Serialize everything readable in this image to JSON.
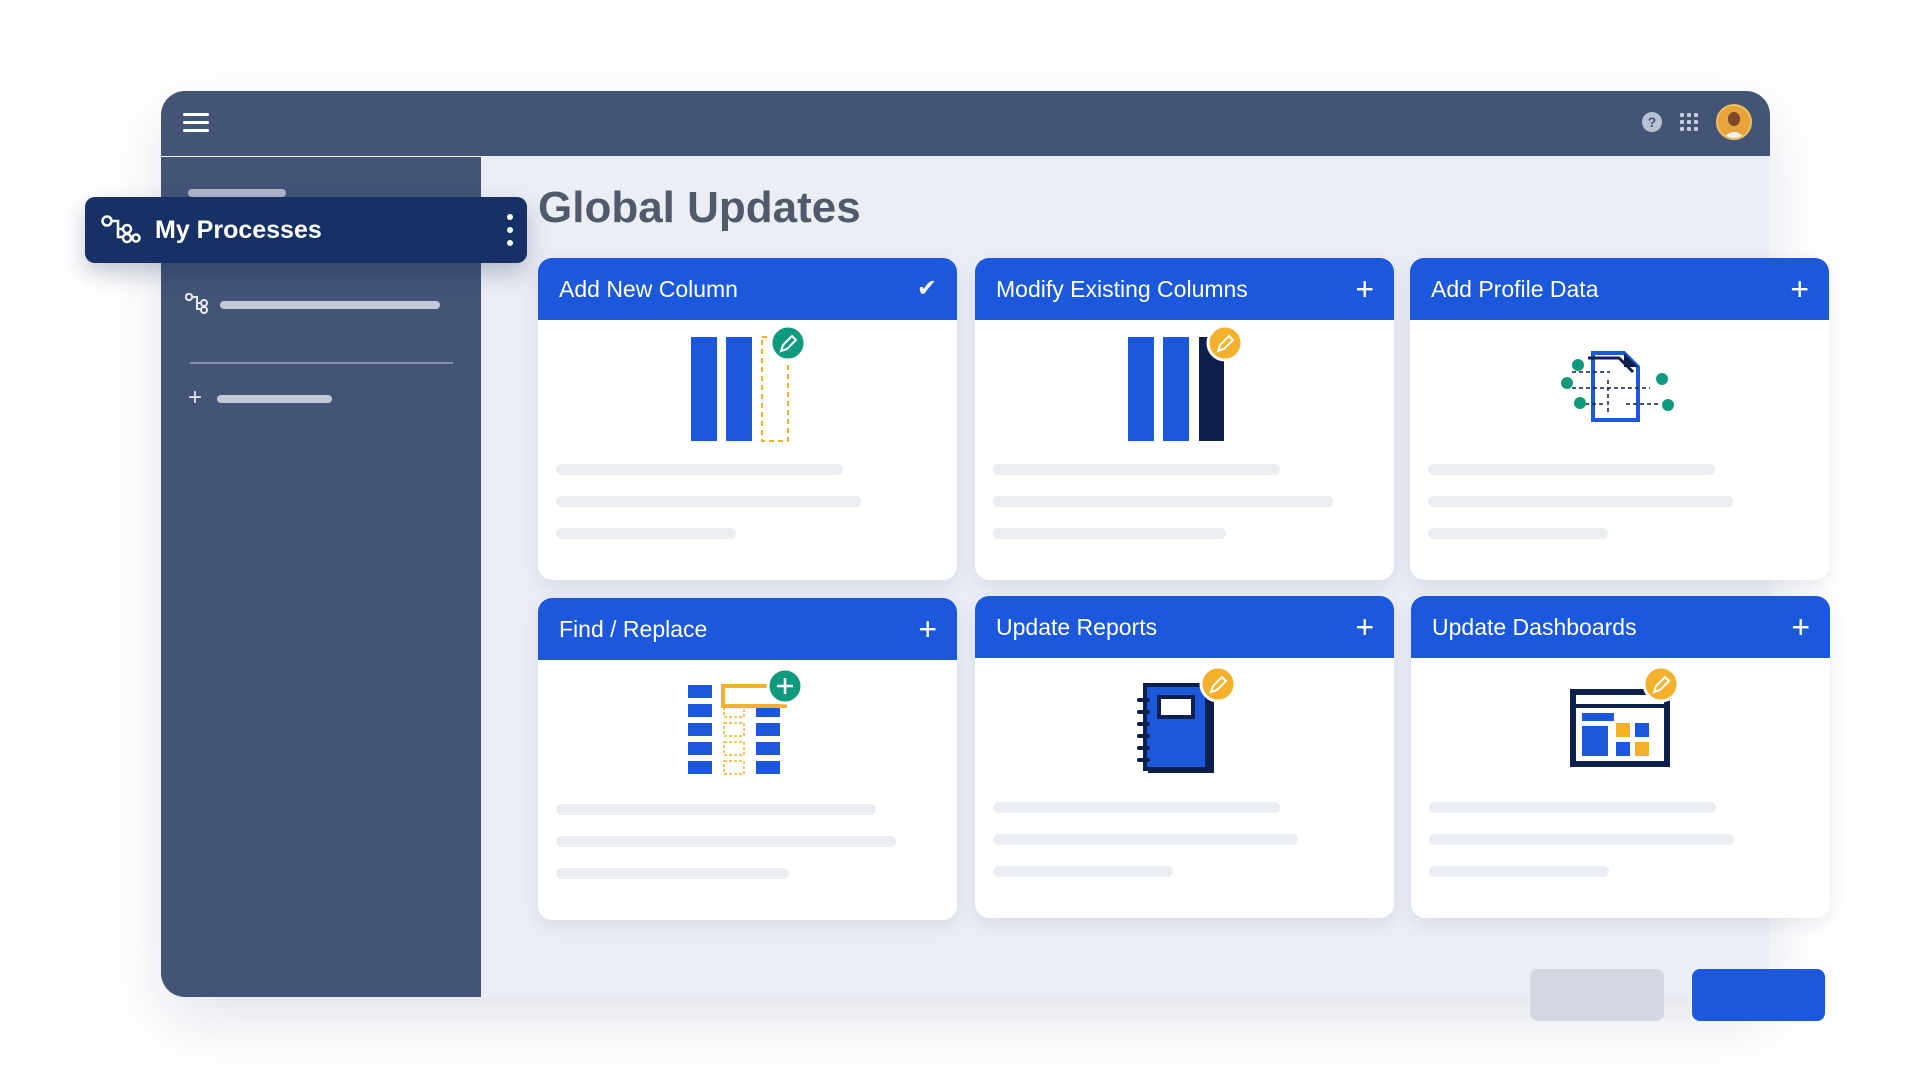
{
  "page": {
    "title": "Global Updates"
  },
  "sidebar": {
    "active_item": "My Processes"
  },
  "cards": [
    {
      "title": "Add New Column",
      "action_icon": "check-icon"
    },
    {
      "title": "Modify Existing Columns",
      "action_icon": "plus-icon"
    },
    {
      "title": "Add Profile Data",
      "action_icon": "plus-icon"
    },
    {
      "title": "Find / Replace",
      "action_icon": "plus-icon"
    },
    {
      "title": "Update Reports",
      "action_icon": "plus-icon"
    },
    {
      "title": "Update Dashboards",
      "action_icon": "plus-icon"
    }
  ],
  "icons": {
    "check": "✔",
    "plus": "+"
  },
  "colors": {
    "topbar": "#435477",
    "active_item": "#173166",
    "card_header": "#1b58db",
    "accent_teal": "#0f9a7e",
    "accent_yellow": "#f6b12c",
    "navy": "#0e1f4d"
  }
}
